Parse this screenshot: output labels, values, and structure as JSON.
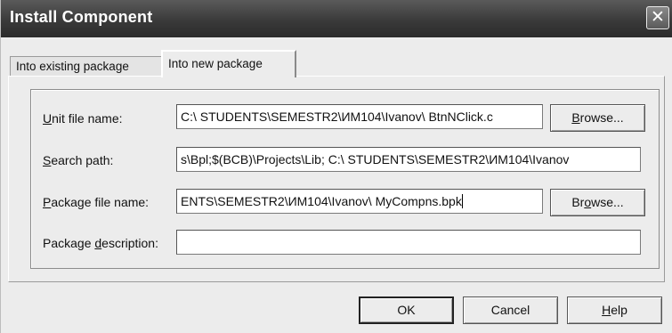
{
  "window": {
    "title": "Install Component",
    "close_glyph": "✕"
  },
  "tabs": [
    {
      "label": "Into existing package",
      "active": false
    },
    {
      "label": "Into new package",
      "active": true
    }
  ],
  "form": {
    "unit_file": {
      "label_mnemonic": "U",
      "label_rest": "nit file name:",
      "value": "C:\\ STUDENTS\\SEMESTR2\\ИМ104\\Ivanov\\ BtnNClick.c",
      "browse_mnemonic": "B",
      "browse_rest": "rowse..."
    },
    "search_path": {
      "label_mnemonic": "S",
      "label_rest": "earch path:",
      "value": "s\\Bpl;$(BCB)\\Projects\\Lib;   C:\\ STUDENTS\\SEMESTR2\\ИМ104\\Ivanov"
    },
    "package_file": {
      "label_mnemonic": "P",
      "label_rest": "ackage file name:",
      "value": "ENTS\\SEMESTR2\\ИМ104\\Ivanov\\ MyCompns.bpk",
      "browse_pre": "Br",
      "browse_mnemonic": "o",
      "browse_rest": "wse..."
    },
    "package_description": {
      "label_pre": "Package ",
      "label_mnemonic": "d",
      "label_rest": "escription:",
      "value": ""
    }
  },
  "buttons": {
    "ok": "OK",
    "cancel": "Cancel",
    "help_mnemonic": "H",
    "help_rest": "elp"
  }
}
